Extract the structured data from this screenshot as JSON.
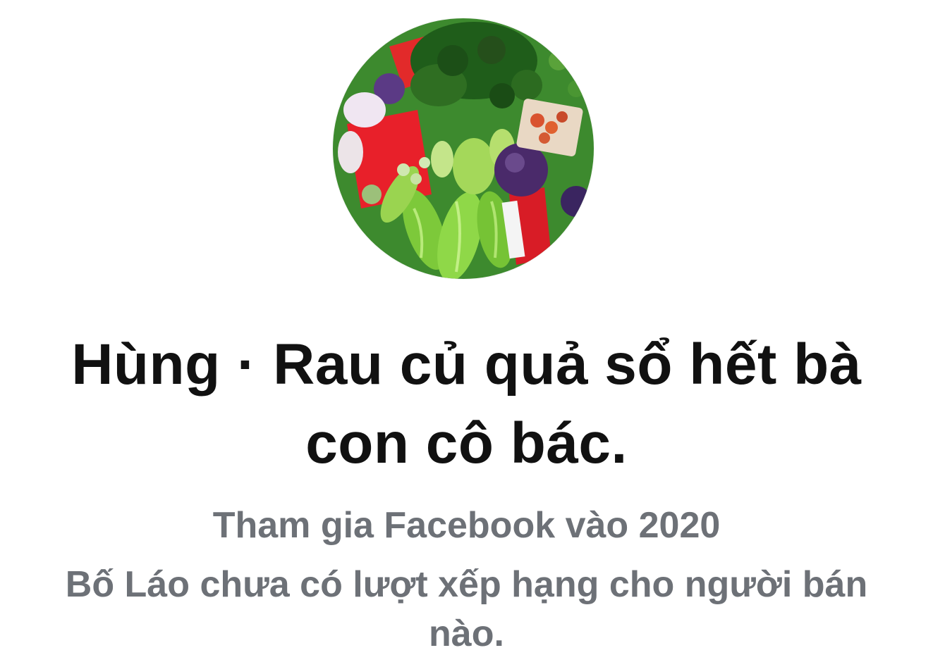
{
  "profile": {
    "avatar_icon": "vegetables-photo-avatar",
    "name": "Hùng · Rau củ quả sổ hết bà con cô bác.",
    "joined_text": "Tham gia Facebook vào 2020",
    "rating_text": "Bố Láo chưa có lượt xếp hạng cho người bán nào."
  },
  "colors": {
    "name_text": "#111111",
    "secondary_text": "#6d7177",
    "background": "#ffffff"
  }
}
